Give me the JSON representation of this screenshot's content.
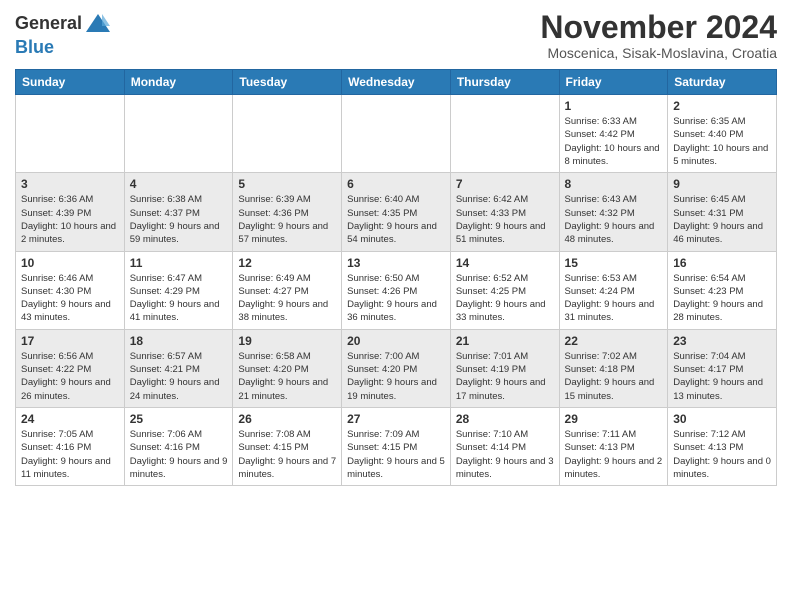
{
  "header": {
    "logo_line1": "General",
    "logo_line2": "Blue",
    "month_title": "November 2024",
    "location": "Moscenica, Sisak-Moslavina, Croatia"
  },
  "days_of_week": [
    "Sunday",
    "Monday",
    "Tuesday",
    "Wednesday",
    "Thursday",
    "Friday",
    "Saturday"
  ],
  "weeks": [
    [
      {
        "day": "",
        "info": ""
      },
      {
        "day": "",
        "info": ""
      },
      {
        "day": "",
        "info": ""
      },
      {
        "day": "",
        "info": ""
      },
      {
        "day": "",
        "info": ""
      },
      {
        "day": "1",
        "info": "Sunrise: 6:33 AM\nSunset: 4:42 PM\nDaylight: 10 hours and 8 minutes."
      },
      {
        "day": "2",
        "info": "Sunrise: 6:35 AM\nSunset: 4:40 PM\nDaylight: 10 hours and 5 minutes."
      }
    ],
    [
      {
        "day": "3",
        "info": "Sunrise: 6:36 AM\nSunset: 4:39 PM\nDaylight: 10 hours and 2 minutes."
      },
      {
        "day": "4",
        "info": "Sunrise: 6:38 AM\nSunset: 4:37 PM\nDaylight: 9 hours and 59 minutes."
      },
      {
        "day": "5",
        "info": "Sunrise: 6:39 AM\nSunset: 4:36 PM\nDaylight: 9 hours and 57 minutes."
      },
      {
        "day": "6",
        "info": "Sunrise: 6:40 AM\nSunset: 4:35 PM\nDaylight: 9 hours and 54 minutes."
      },
      {
        "day": "7",
        "info": "Sunrise: 6:42 AM\nSunset: 4:33 PM\nDaylight: 9 hours and 51 minutes."
      },
      {
        "day": "8",
        "info": "Sunrise: 6:43 AM\nSunset: 4:32 PM\nDaylight: 9 hours and 48 minutes."
      },
      {
        "day": "9",
        "info": "Sunrise: 6:45 AM\nSunset: 4:31 PM\nDaylight: 9 hours and 46 minutes."
      }
    ],
    [
      {
        "day": "10",
        "info": "Sunrise: 6:46 AM\nSunset: 4:30 PM\nDaylight: 9 hours and 43 minutes."
      },
      {
        "day": "11",
        "info": "Sunrise: 6:47 AM\nSunset: 4:29 PM\nDaylight: 9 hours and 41 minutes."
      },
      {
        "day": "12",
        "info": "Sunrise: 6:49 AM\nSunset: 4:27 PM\nDaylight: 9 hours and 38 minutes."
      },
      {
        "day": "13",
        "info": "Sunrise: 6:50 AM\nSunset: 4:26 PM\nDaylight: 9 hours and 36 minutes."
      },
      {
        "day": "14",
        "info": "Sunrise: 6:52 AM\nSunset: 4:25 PM\nDaylight: 9 hours and 33 minutes."
      },
      {
        "day": "15",
        "info": "Sunrise: 6:53 AM\nSunset: 4:24 PM\nDaylight: 9 hours and 31 minutes."
      },
      {
        "day": "16",
        "info": "Sunrise: 6:54 AM\nSunset: 4:23 PM\nDaylight: 9 hours and 28 minutes."
      }
    ],
    [
      {
        "day": "17",
        "info": "Sunrise: 6:56 AM\nSunset: 4:22 PM\nDaylight: 9 hours and 26 minutes."
      },
      {
        "day": "18",
        "info": "Sunrise: 6:57 AM\nSunset: 4:21 PM\nDaylight: 9 hours and 24 minutes."
      },
      {
        "day": "19",
        "info": "Sunrise: 6:58 AM\nSunset: 4:20 PM\nDaylight: 9 hours and 21 minutes."
      },
      {
        "day": "20",
        "info": "Sunrise: 7:00 AM\nSunset: 4:20 PM\nDaylight: 9 hours and 19 minutes."
      },
      {
        "day": "21",
        "info": "Sunrise: 7:01 AM\nSunset: 4:19 PM\nDaylight: 9 hours and 17 minutes."
      },
      {
        "day": "22",
        "info": "Sunrise: 7:02 AM\nSunset: 4:18 PM\nDaylight: 9 hours and 15 minutes."
      },
      {
        "day": "23",
        "info": "Sunrise: 7:04 AM\nSunset: 4:17 PM\nDaylight: 9 hours and 13 minutes."
      }
    ],
    [
      {
        "day": "24",
        "info": "Sunrise: 7:05 AM\nSunset: 4:16 PM\nDaylight: 9 hours and 11 minutes."
      },
      {
        "day": "25",
        "info": "Sunrise: 7:06 AM\nSunset: 4:16 PM\nDaylight: 9 hours and 9 minutes."
      },
      {
        "day": "26",
        "info": "Sunrise: 7:08 AM\nSunset: 4:15 PM\nDaylight: 9 hours and 7 minutes."
      },
      {
        "day": "27",
        "info": "Sunrise: 7:09 AM\nSunset: 4:15 PM\nDaylight: 9 hours and 5 minutes."
      },
      {
        "day": "28",
        "info": "Sunrise: 7:10 AM\nSunset: 4:14 PM\nDaylight: 9 hours and 3 minutes."
      },
      {
        "day": "29",
        "info": "Sunrise: 7:11 AM\nSunset: 4:13 PM\nDaylight: 9 hours and 2 minutes."
      },
      {
        "day": "30",
        "info": "Sunrise: 7:12 AM\nSunset: 4:13 PM\nDaylight: 9 hours and 0 minutes."
      }
    ]
  ]
}
